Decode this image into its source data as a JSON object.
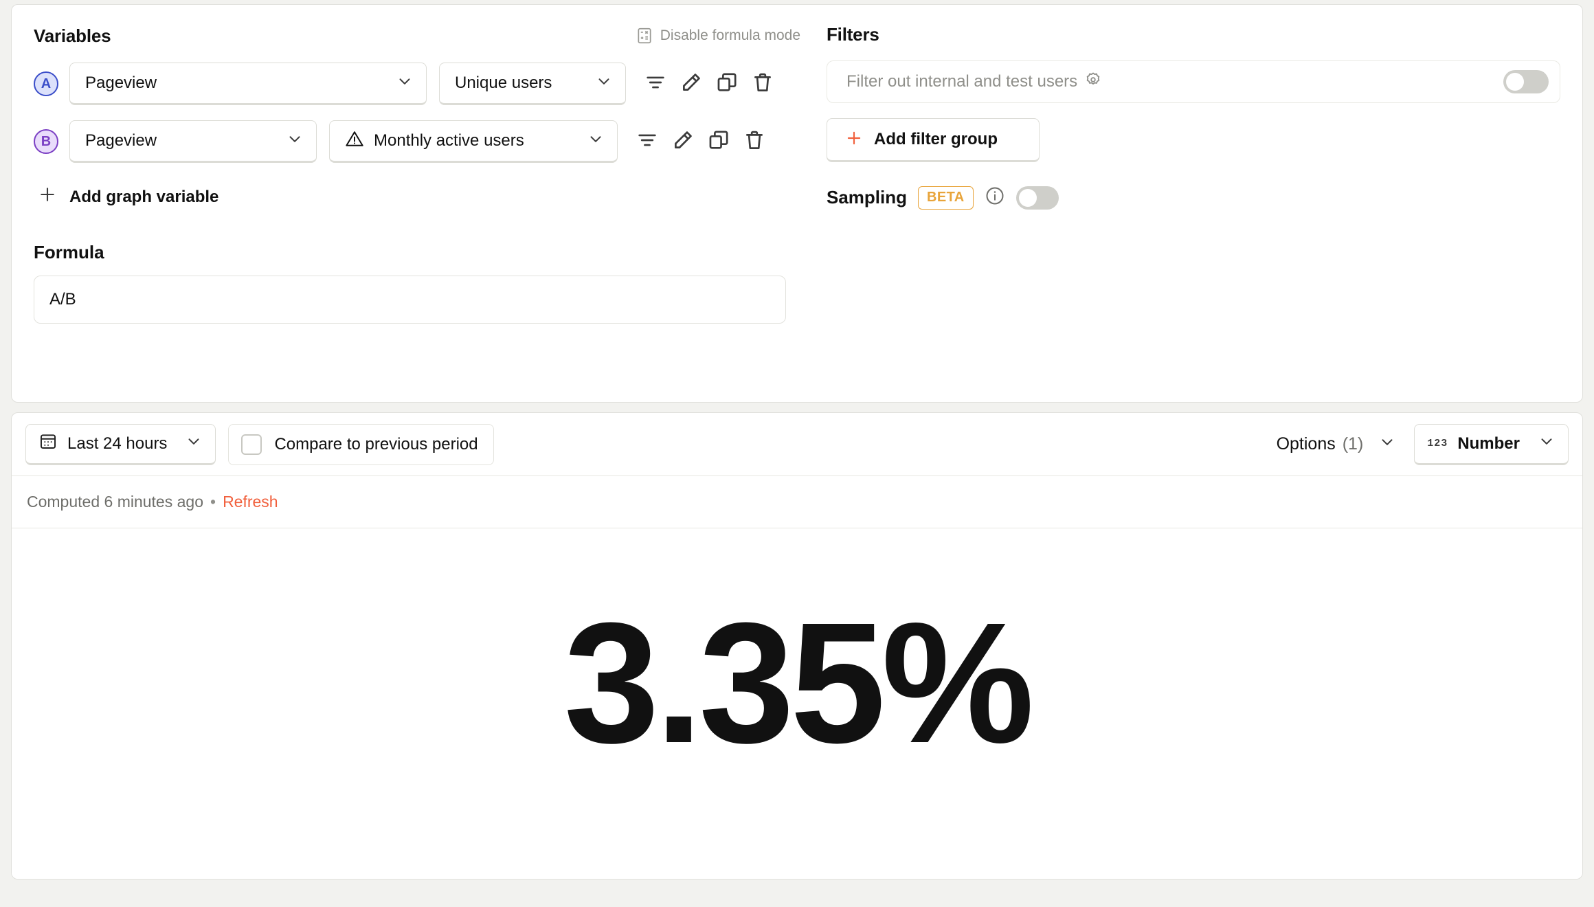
{
  "variables": {
    "title": "Variables",
    "formula_mode_label": "Disable formula mode",
    "formula_mode_icon": "calculator-icon",
    "rows": [
      {
        "badge": "A",
        "badge_color": "#3b4ec9",
        "event": "Pageview",
        "math": "Unique users",
        "has_warning": false
      },
      {
        "badge": "B",
        "badge_color": "#7b3fc4",
        "event": "Pageview",
        "math": "Monthly active users",
        "has_warning": true
      }
    ],
    "row_action_icons": [
      "filter-icon",
      "edit-icon",
      "duplicate-icon",
      "delete-icon"
    ],
    "add_variable_label": "Add graph variable"
  },
  "formula": {
    "title": "Formula",
    "value": "A/B",
    "placeholder": "A/B"
  },
  "filters": {
    "title": "Filters",
    "internal_filter_label": "Filter out internal and test users",
    "internal_filter_gear_icon": "gear-icon",
    "internal_filter_enabled": false,
    "add_filter_group_label": "Add filter group",
    "sampling": {
      "label": "Sampling",
      "badge": "BETA",
      "badge_color": "#e8a43a",
      "info_icon": "info-icon",
      "enabled": false
    }
  },
  "toolbar": {
    "date_range": "Last 24 hours",
    "date_range_icon": "calendar-icon",
    "compare_label": "Compare to previous period",
    "compare_checked": false,
    "options_label": "Options",
    "options_count": "(1)",
    "display_type": "Number",
    "display_type_icon": "123-icon"
  },
  "result": {
    "computed_text": "Computed 6 minutes ago",
    "separator": "•",
    "refresh_label": "Refresh",
    "value": "3.35%"
  },
  "colors": {
    "accent_orange": "#f1603d",
    "page_bg": "#f2f2ef",
    "card_bg": "#ffffff",
    "beta_amber": "#e8a43a"
  }
}
